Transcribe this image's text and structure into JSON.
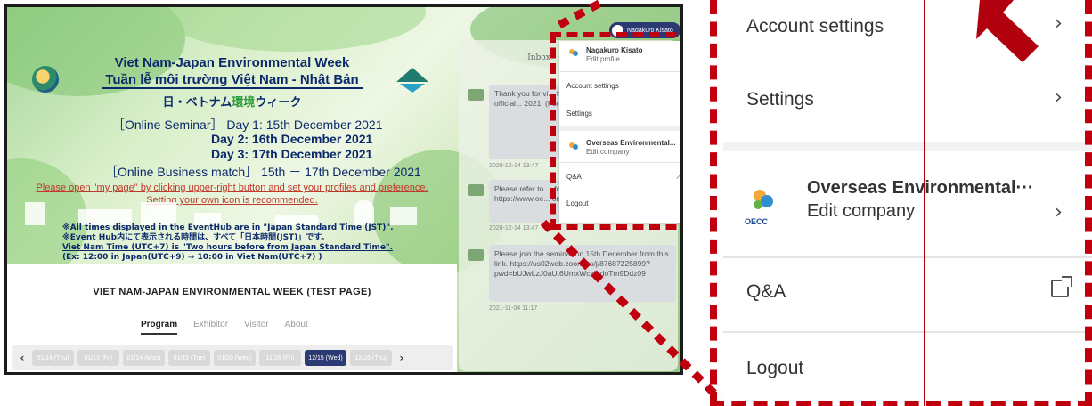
{
  "event": {
    "title_en": "Viet Nam-Japan Environmental Week",
    "title_vi": "Tuần lễ môi trường Việt Nam  - Nhật Bản",
    "title_jp_pre": "日・ベトナム",
    "title_jp_green": "環境",
    "title_jp_post": "ウィーク",
    "seminar_line": "［Online Seminar］ Day 1: 15th December 2021",
    "day2": "Day 2: 16th December 2021",
    "day3": "Day 3: 17th December 2021",
    "business_line": "［Online Business match］ 15th － 17th December 2021",
    "notice_1": "Please open \"my page\" by clicking upper-right button and set your profiles and preference.",
    "notice_2": "Setting your own icon is recommended.",
    "tz_1": "※All times displayed in the EventHub are in \"Japan Standard Time (JST)\".",
    "tz_2": "※Event Hub内にて表示される時間は、すべて「日本時間(JST)」です。",
    "tz_3": "Viet Nam Time (UTC+7) is \"Two hours before from Japan Standard Time\".",
    "tz_4": "(Ex: 12:00 in Japan(UTC+9) ⇒ 10:00 in Viet Nam(UTC+7) )"
  },
  "page": {
    "heading": "VIET NAM-JAPAN ENVIRONMENTAL WEEK (TEST PAGE)",
    "tabs": [
      "Program",
      "Exhibitor",
      "Visitor",
      "About"
    ],
    "dates": [
      "01/14 (Thu)",
      "01/13 (Fri)",
      "01/14 (Mon)",
      "01/15 (Tue)",
      "01/20 (Wed)",
      "11/26 (Fri)",
      "12/15 (Wed)",
      "12/16 (Thu)"
    ],
    "prev_arrow": "‹",
    "next_arrow": "›"
  },
  "inbox": {
    "title": "Inbox",
    "messages": [
      {
        "text": "Thank you for vi... the Indonesia-... which will official... 2021. (For your conven... set title is reco...",
        "time": "2020-12-14 13:47"
      },
      {
        "text": "Please refer to ... for this event sit... https://www.oe... ommon/files/pr...",
        "time": "2020-12-14 13:47"
      },
      {
        "text": "Please join the seminar on 15th December from this link. https://us02web.zoom.us/j/87687225899?pwd=bUJwLzJ0aUt6UmxWczbtdoTm9Ddz09",
        "time": "2021-11-04 11:17"
      }
    ]
  },
  "user": {
    "pill_name": "Nagakuro Kisato"
  },
  "menu_small": {
    "user_name": "Nagakuro Kisato",
    "edit_profile": "Edit profile",
    "account_settings": "Account settings",
    "settings": "Settings",
    "company_name": "Overseas Environmental...",
    "edit_company": "Edit company",
    "qa": "Q&A",
    "logout": "Logout",
    "chevron": "›"
  },
  "menu_zoom": {
    "account_settings": "Account settings",
    "settings": "Settings",
    "company_name": "Overseas Environmental···",
    "edit_company": "Edit company",
    "qa": "Q&A",
    "logout": "Logout",
    "chevron": "›",
    "logo_text": "OECC"
  },
  "colors": {
    "highlight": "#c0000f",
    "navy": "#2c3a73",
    "title_blue": "#0c2a6b"
  }
}
